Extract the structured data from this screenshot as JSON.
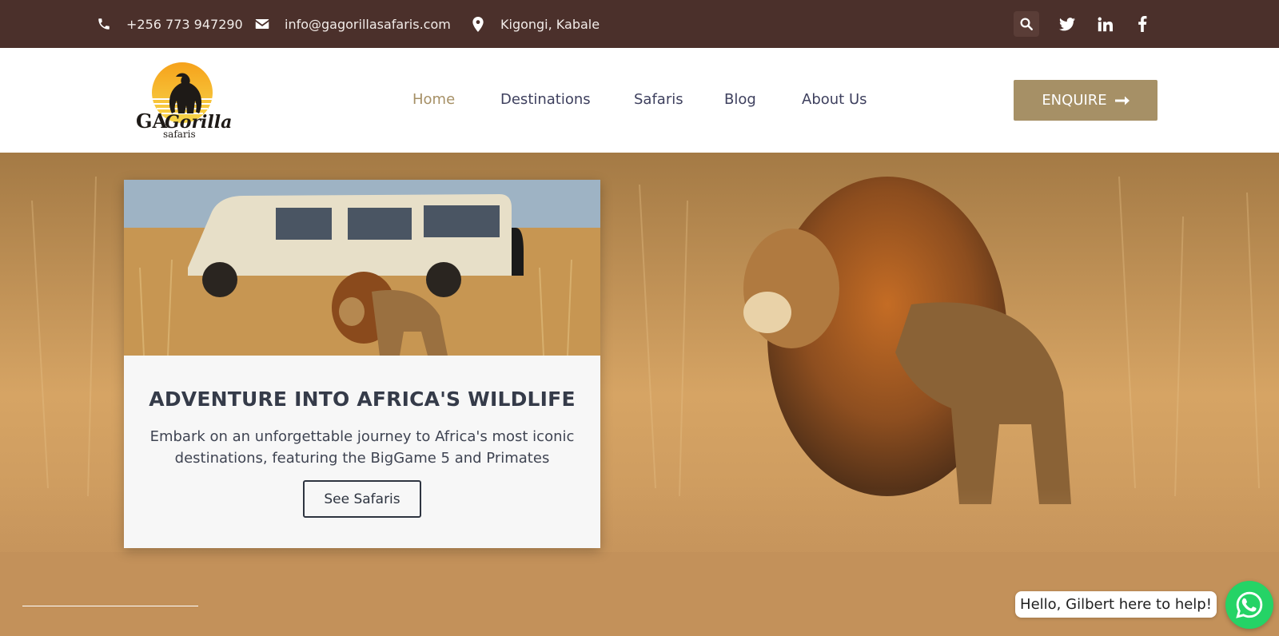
{
  "topbar": {
    "phone": "+256 773 947290",
    "email": "info@gagorillasafaris.com",
    "location": "Kigongi, Kabale",
    "icons": [
      "phone-icon",
      "envelope-icon",
      "map-pin-icon",
      "search-icon",
      "twitter-icon",
      "linkedin-icon",
      "facebook-icon"
    ]
  },
  "logo": {
    "brand": "GA Gorilla",
    "sub": "safaris"
  },
  "nav": {
    "items": [
      {
        "label": "Home",
        "active": true
      },
      {
        "label": "Destinations",
        "active": false
      },
      {
        "label": "Safaris",
        "active": false
      },
      {
        "label": "Blog",
        "active": false
      },
      {
        "label": "About Us",
        "active": false
      }
    ],
    "enquire_label": "ENQUIRE"
  },
  "hero": {
    "card_title": "ADVENTURE INTO AFRICA'S WILDLIFE",
    "card_text": "Embark on an unforgettable journey to Africa's most iconic destinations, featuring the BigGame 5 and Primates",
    "cta_label": "See Safaris"
  },
  "chat": {
    "bubble_text": "Hello, Gilbert here to help!"
  },
  "colors": {
    "topbar_bg": "#4b302b",
    "accent": "#a69066",
    "nav_text": "#3e405e",
    "hero_bg": "#c3915a",
    "whatsapp": "#25d366"
  }
}
